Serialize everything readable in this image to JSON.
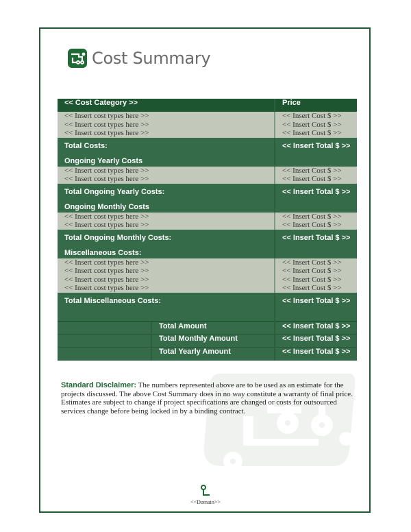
{
  "document": {
    "title": "Cost Summary",
    "logo_icon": "circuit-board-logo-icon",
    "watermark_icon": "circuit-board-watermark-icon",
    "colors": {
      "header_dark": "#1d5531",
      "row_dark": "#356b48",
      "row_light": "#c2c9ba",
      "title_gray": "#6b6b6b",
      "accent_green": "#1f6b35"
    }
  },
  "table": {
    "headers": {
      "category": "<< Cost Category >>",
      "price": "Price"
    },
    "sections": [
      {
        "items": [
          {
            "label": "<< Insert cost types here >>",
            "price": "<< Insert Cost $ >>"
          },
          {
            "label": "<< Insert cost types here >>",
            "price": "<< Insert Cost $ >>"
          },
          {
            "label": "<< Insert cost types here >>",
            "price": "<< Insert Cost $ >>"
          }
        ],
        "total_label": "Total Costs:",
        "total_value": "<< Insert Total $ >>",
        "next_heading": "Ongoing Yearly Costs"
      },
      {
        "items": [
          {
            "label": "<< Insert cost types here >>",
            "price": "<< Insert Cost $ >>"
          },
          {
            "label": "<< Insert cost types here >>",
            "price": "<< Insert Cost $ >>"
          }
        ],
        "total_label": "Total Ongoing Yearly Costs:",
        "total_value": "<< Insert Total $ >>",
        "next_heading": "Ongoing Monthly Costs"
      },
      {
        "items": [
          {
            "label": "<< Insert cost types here >>",
            "price": "<< Insert Cost $ >>"
          },
          {
            "label": "<< Insert cost types here >>",
            "price": "<< Insert Cost $ >>"
          }
        ],
        "total_label": "Total Ongoing Monthly Costs:",
        "total_value": "<< Insert Total $ >>",
        "next_heading": "Miscellaneous Costs:"
      },
      {
        "items": [
          {
            "label": "<< Insert cost types here >>",
            "price": "<< Insert Cost $ >>"
          },
          {
            "label": "<< Insert cost types here >>",
            "price": "<< Insert Cost $ >>"
          },
          {
            "label": "<< Insert cost types here >>",
            "price": "<< Insert Cost $ >>"
          },
          {
            "label": "<< Insert cost types here >>",
            "price": "<< Insert Cost $ >>"
          }
        ],
        "total_label": "Total Miscellaneous Costs:",
        "total_value": "<< Insert Total $ >>",
        "next_heading": ""
      }
    ],
    "summary": [
      {
        "label": "Total Amount",
        "value": "<< Insert Total $ >>"
      },
      {
        "label": "Total Monthly Amount",
        "value": "<< Insert Total $ >>"
      },
      {
        "label": "Total Yearly Amount",
        "value": "<< Insert Total $ >>"
      }
    ]
  },
  "disclaimer": {
    "lead": "Standard Disclaimer:",
    "body": " The numbers represented above are to be used as an estimate for the projects discussed. The above Cost Summary does in no way constitute a warranty of final price. Estimates are subject to change if project specifications are changed or costs for outsourced services change before being locked in by a binding contract."
  },
  "footer": {
    "icon": "circuit-node-icon",
    "text": "<<Domain>>"
  }
}
